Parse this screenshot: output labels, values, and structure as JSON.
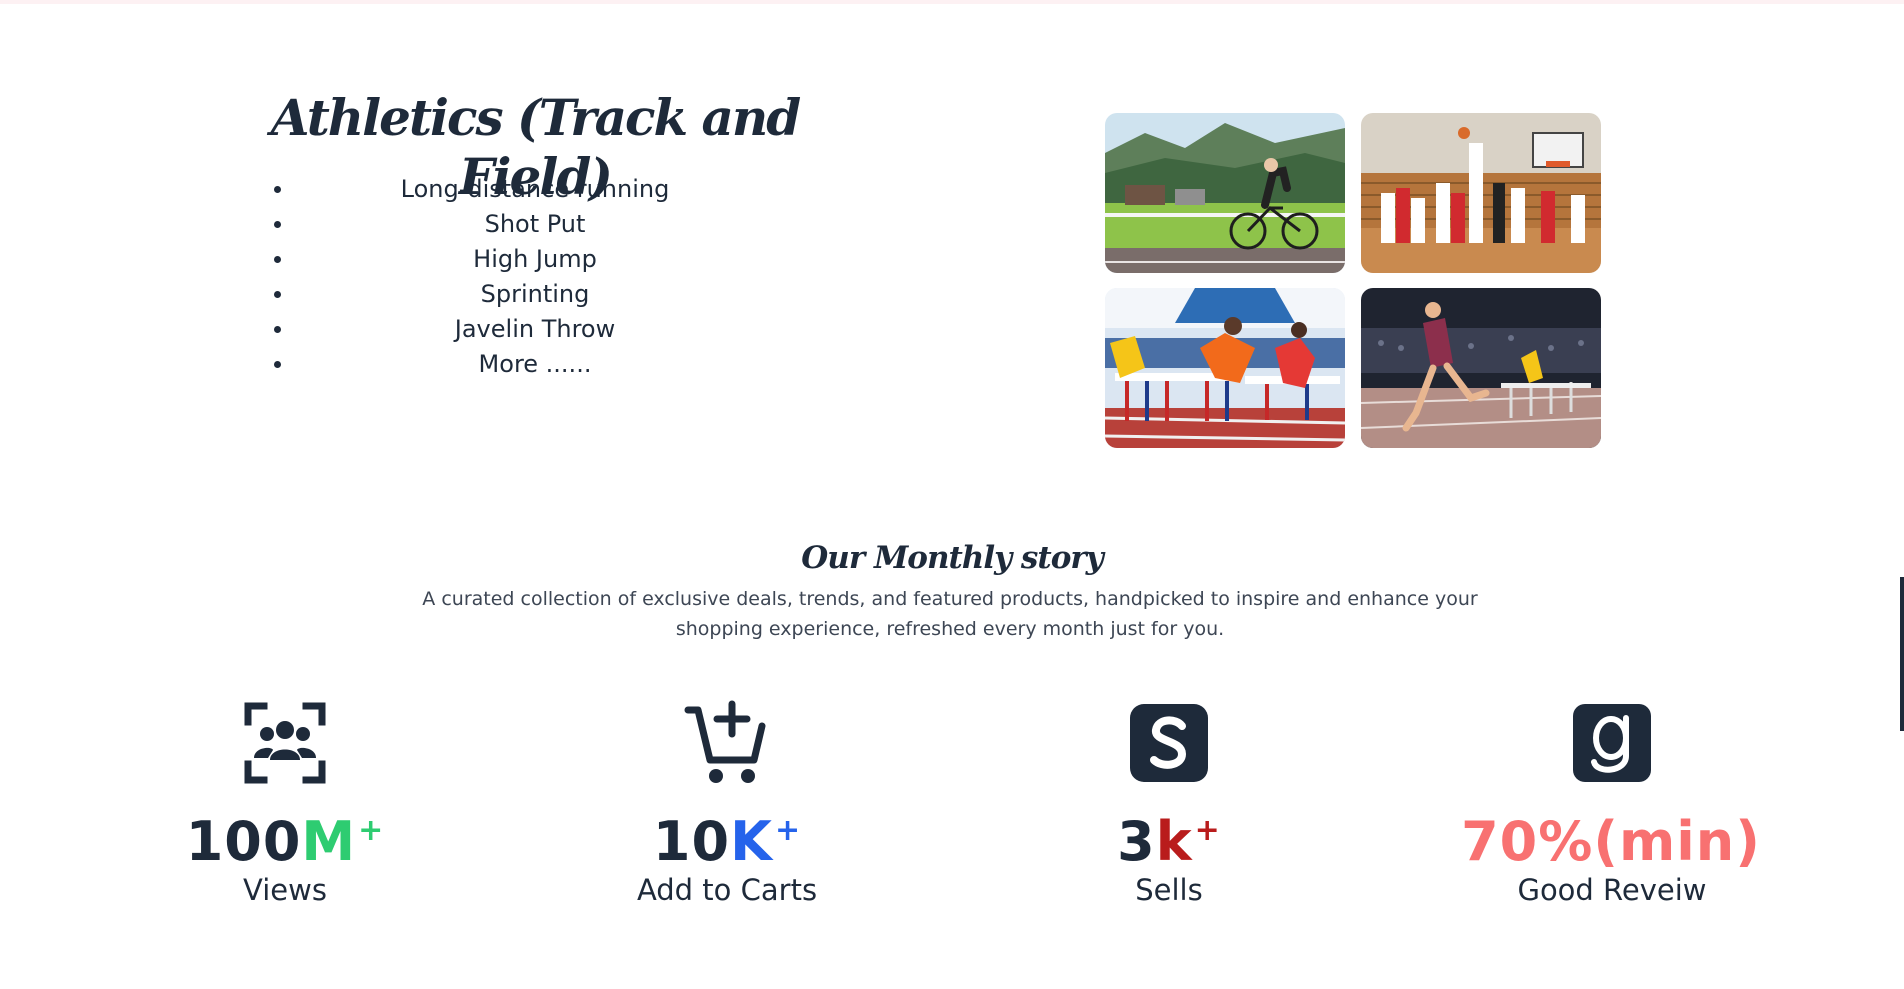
{
  "athletics": {
    "title": "Athletics (Track and Field)",
    "items": [
      "Long-distance running",
      "Shot Put",
      "High Jump",
      "Sprinting",
      "Javelin Throw",
      "More ......"
    ]
  },
  "gallery": {
    "photos": [
      "cyclist-photo",
      "basketball-photo",
      "hurdles-photo",
      "runner-photo"
    ]
  },
  "story": {
    "title": "Our Monthly story",
    "description": "A curated collection of exclusive deals, trends, and featured products, handpicked to inspire and enhance your shopping experience, refreshed every month just for you."
  },
  "stats": [
    {
      "icon": "users-scan-icon",
      "number": "100",
      "suffix": "M",
      "plus": "+",
      "suffix_color": "#2ecc71",
      "label": "Views"
    },
    {
      "icon": "cart-plus-icon",
      "number": "10",
      "suffix": "K",
      "plus": "+",
      "suffix_color": "#2563eb",
      "label": "Add to Carts"
    },
    {
      "icon": "skype-style-s-icon",
      "number": "3",
      "suffix": "k",
      "plus": "+",
      "suffix_color": "#b91c1c",
      "label": "Sells"
    },
    {
      "icon": "goodreads-g-icon",
      "number": "",
      "suffix": "70%(min)",
      "plus": "",
      "suffix_color": "#f87171",
      "label": "Good Reveiw"
    }
  ],
  "colors": {
    "text": "#1e2a3a",
    "muted": "#3d4654",
    "green": "#2ecc71",
    "blue": "#2563eb",
    "red": "#b91c1c",
    "salmon": "#f87171"
  }
}
